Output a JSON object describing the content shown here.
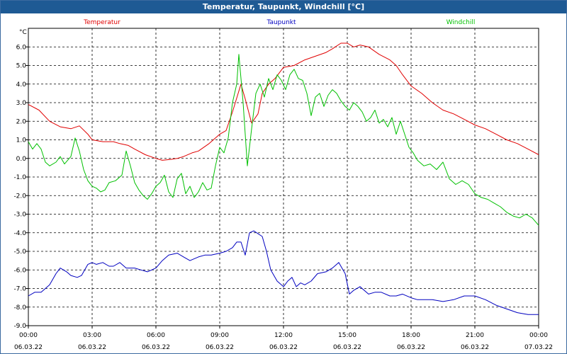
{
  "window": {
    "title": "Temperatur, Taupunkt, Windchill [°C]"
  },
  "legend": {
    "temperatur": {
      "label": "Temperatur",
      "color": "#e00000"
    },
    "taupunkt": {
      "label": "Taupunkt",
      "color": "#0000c0"
    },
    "windchill": {
      "label": "Windchill",
      "color": "#00c000"
    }
  },
  "chart_data": {
    "type": "line",
    "title": "Temperatur, Taupunkt, Windchill [°C]",
    "ylabel": "°C",
    "xlabel": "",
    "ylim": [
      -9.0,
      7.0
    ],
    "xlim": [
      0,
      24
    ],
    "yticks": [
      6.0,
      5.0,
      4.0,
      3.0,
      2.0,
      1.0,
      0.0,
      -1.0,
      -2.0,
      -3.0,
      -4.0,
      -5.0,
      -6.0,
      -7.0,
      -8.0,
      -9.0
    ],
    "ytick_labels": [
      "6.0",
      "5.0",
      "4.0",
      "3.0",
      "2.0",
      "1.0",
      "0.0",
      "-1.0",
      "-2.0",
      "-3.0",
      "-4.0",
      "-5.0",
      "-6.0",
      "-7.0",
      "-8.0",
      "-9.0"
    ],
    "xticks": [
      {
        "x": 0,
        "time": "00:00",
        "date": "06.03.22"
      },
      {
        "x": 3,
        "time": "03:00",
        "date": "06.03.22"
      },
      {
        "x": 6,
        "time": "06:00",
        "date": "06.03.22"
      },
      {
        "x": 9,
        "time": "09:00",
        "date": "06.03.22"
      },
      {
        "x": 12,
        "time": "12:00",
        "date": "06.03.22"
      },
      {
        "x": 15,
        "time": "15:00",
        "date": "06.03.22"
      },
      {
        "x": 18,
        "time": "18:00",
        "date": "06.03.22"
      },
      {
        "x": 21,
        "time": "21:00",
        "date": "06.03.22"
      },
      {
        "x": 24,
        "time": "00:00",
        "date": "07.03.22"
      }
    ],
    "grid": true,
    "legend_position": "top",
    "series": [
      {
        "name": "Temperatur",
        "color": "#e00000",
        "points": [
          [
            0,
            2.9
          ],
          [
            0.5,
            2.6
          ],
          [
            1,
            2.0
          ],
          [
            1.5,
            1.7
          ],
          [
            2,
            1.6
          ],
          [
            2.4,
            1.75
          ],
          [
            2.8,
            1.3
          ],
          [
            3,
            1.0
          ],
          [
            3.5,
            0.9
          ],
          [
            4,
            0.9
          ],
          [
            4.3,
            0.8
          ],
          [
            4.7,
            0.7
          ],
          [
            5,
            0.5
          ],
          [
            5.5,
            0.2
          ],
          [
            6,
            0.0
          ],
          [
            6.3,
            -0.1
          ],
          [
            6.7,
            -0.05
          ],
          [
            7,
            0.0
          ],
          [
            7.3,
            0.1
          ],
          [
            7.7,
            0.3
          ],
          [
            8,
            0.4
          ],
          [
            8.5,
            0.8
          ],
          [
            9,
            1.3
          ],
          [
            9.3,
            1.5
          ],
          [
            9.6,
            2.5
          ],
          [
            10,
            4.0
          ],
          [
            10.2,
            3.2
          ],
          [
            10.5,
            1.9
          ],
          [
            10.8,
            2.4
          ],
          [
            11,
            3.5
          ],
          [
            11.3,
            4.0
          ],
          [
            11.6,
            4.3
          ],
          [
            12,
            4.9
          ],
          [
            12.5,
            5.0
          ],
          [
            13,
            5.3
          ],
          [
            13.5,
            5.5
          ],
          [
            14,
            5.7
          ],
          [
            14.3,
            5.9
          ],
          [
            14.7,
            6.2
          ],
          [
            15,
            6.2
          ],
          [
            15.3,
            6.0
          ],
          [
            15.6,
            6.1
          ],
          [
            16,
            6.0
          ],
          [
            16.5,
            5.6
          ],
          [
            17,
            5.3
          ],
          [
            17.3,
            5.0
          ],
          [
            17.6,
            4.5
          ],
          [
            18,
            3.9
          ],
          [
            18.5,
            3.5
          ],
          [
            19,
            3.0
          ],
          [
            19.5,
            2.6
          ],
          [
            20,
            2.4
          ],
          [
            20.5,
            2.1
          ],
          [
            21,
            1.8
          ],
          [
            21.5,
            1.6
          ],
          [
            22,
            1.3
          ],
          [
            22.5,
            1.0
          ],
          [
            23,
            0.8
          ],
          [
            23.5,
            0.5
          ],
          [
            24,
            0.2
          ]
        ]
      },
      {
        "name": "Taupunkt",
        "color": "#0000c0",
        "points": [
          [
            0,
            -7.4
          ],
          [
            0.3,
            -7.2
          ],
          [
            0.6,
            -7.2
          ],
          [
            1,
            -6.8
          ],
          [
            1.3,
            -6.2
          ],
          [
            1.5,
            -5.9
          ],
          [
            1.8,
            -6.1
          ],
          [
            2,
            -6.3
          ],
          [
            2.3,
            -6.4
          ],
          [
            2.5,
            -6.3
          ],
          [
            2.8,
            -5.7
          ],
          [
            3,
            -5.6
          ],
          [
            3.2,
            -5.7
          ],
          [
            3.5,
            -5.6
          ],
          [
            3.8,
            -5.8
          ],
          [
            4,
            -5.8
          ],
          [
            4.3,
            -5.6
          ],
          [
            4.6,
            -5.9
          ],
          [
            5,
            -5.9
          ],
          [
            5.3,
            -6.0
          ],
          [
            5.6,
            -6.1
          ],
          [
            6,
            -5.9
          ],
          [
            6.3,
            -5.5
          ],
          [
            6.6,
            -5.2
          ],
          [
            7,
            -5.1
          ],
          [
            7.3,
            -5.3
          ],
          [
            7.6,
            -5.5
          ],
          [
            8,
            -5.3
          ],
          [
            8.3,
            -5.2
          ],
          [
            8.6,
            -5.2
          ],
          [
            9,
            -5.1
          ],
          [
            9.3,
            -5.0
          ],
          [
            9.6,
            -4.8
          ],
          [
            9.8,
            -4.5
          ],
          [
            10,
            -4.5
          ],
          [
            10.2,
            -5.2
          ],
          [
            10.4,
            -4.0
          ],
          [
            10.6,
            -3.9
          ],
          [
            11,
            -4.2
          ],
          [
            11.2,
            -5.0
          ],
          [
            11.4,
            -6.0
          ],
          [
            11.7,
            -6.6
          ],
          [
            12,
            -6.9
          ],
          [
            12.2,
            -6.6
          ],
          [
            12.4,
            -6.4
          ],
          [
            12.6,
            -6.9
          ],
          [
            12.8,
            -6.7
          ],
          [
            13,
            -6.8
          ],
          [
            13.3,
            -6.6
          ],
          [
            13.6,
            -6.2
          ],
          [
            14,
            -6.1
          ],
          [
            14.3,
            -5.9
          ],
          [
            14.6,
            -5.6
          ],
          [
            14.9,
            -6.2
          ],
          [
            15.1,
            -7.3
          ],
          [
            15.3,
            -7.1
          ],
          [
            15.6,
            -6.9
          ],
          [
            16,
            -7.3
          ],
          [
            16.3,
            -7.2
          ],
          [
            16.6,
            -7.2
          ],
          [
            17,
            -7.4
          ],
          [
            17.3,
            -7.4
          ],
          [
            17.6,
            -7.3
          ],
          [
            18,
            -7.5
          ],
          [
            18.3,
            -7.6
          ],
          [
            18.6,
            -7.6
          ],
          [
            19,
            -7.6
          ],
          [
            19.5,
            -7.7
          ],
          [
            20,
            -7.6
          ],
          [
            20.5,
            -7.4
          ],
          [
            21,
            -7.4
          ],
          [
            21.5,
            -7.6
          ],
          [
            22,
            -7.9
          ],
          [
            22.5,
            -8.1
          ],
          [
            23,
            -8.3
          ],
          [
            23.5,
            -8.4
          ],
          [
            24,
            -8.4
          ]
        ]
      },
      {
        "name": "Windchill",
        "color": "#00c000",
        "points": [
          [
            0,
            0.9
          ],
          [
            0.2,
            0.5
          ],
          [
            0.4,
            0.8
          ],
          [
            0.6,
            0.5
          ],
          [
            0.8,
            -0.2
          ],
          [
            1,
            -0.4
          ],
          [
            1.3,
            -0.2
          ],
          [
            1.5,
            0.1
          ],
          [
            1.7,
            -0.3
          ],
          [
            2,
            0.1
          ],
          [
            2.2,
            1.1
          ],
          [
            2.4,
            0.4
          ],
          [
            2.6,
            -0.6
          ],
          [
            2.8,
            -1.2
          ],
          [
            3,
            -1.5
          ],
          [
            3.2,
            -1.6
          ],
          [
            3.4,
            -1.8
          ],
          [
            3.6,
            -1.7
          ],
          [
            3.8,
            -1.3
          ],
          [
            4.1,
            -1.2
          ],
          [
            4.4,
            -0.9
          ],
          [
            4.6,
            0.4
          ],
          [
            4.8,
            -0.4
          ],
          [
            5,
            -1.3
          ],
          [
            5.2,
            -1.7
          ],
          [
            5.4,
            -2.0
          ],
          [
            5.6,
            -2.2
          ],
          [
            5.8,
            -1.9
          ],
          [
            6,
            -1.5
          ],
          [
            6.2,
            -1.3
          ],
          [
            6.4,
            -0.9
          ],
          [
            6.6,
            -1.8
          ],
          [
            6.8,
            -2.1
          ],
          [
            7,
            -1.1
          ],
          [
            7.2,
            -0.8
          ],
          [
            7.4,
            -1.9
          ],
          [
            7.6,
            -1.5
          ],
          [
            7.8,
            -2.1
          ],
          [
            8,
            -1.8
          ],
          [
            8.2,
            -1.3
          ],
          [
            8.4,
            -1.7
          ],
          [
            8.6,
            -1.6
          ],
          [
            8.8,
            -0.4
          ],
          [
            9,
            0.6
          ],
          [
            9.2,
            0.3
          ],
          [
            9.4,
            1.1
          ],
          [
            9.6,
            3.0
          ],
          [
            9.8,
            4.0
          ],
          [
            9.9,
            5.6
          ],
          [
            10.1,
            3.0
          ],
          [
            10.3,
            -0.4
          ],
          [
            10.5,
            1.6
          ],
          [
            10.7,
            3.5
          ],
          [
            10.9,
            4.0
          ],
          [
            11.1,
            3.3
          ],
          [
            11.3,
            4.3
          ],
          [
            11.5,
            3.7
          ],
          [
            11.7,
            4.5
          ],
          [
            11.9,
            4.2
          ],
          [
            12.1,
            3.7
          ],
          [
            12.3,
            4.5
          ],
          [
            12.5,
            4.8
          ],
          [
            12.7,
            4.3
          ],
          [
            12.9,
            4.2
          ],
          [
            13.1,
            3.5
          ],
          [
            13.3,
            2.3
          ],
          [
            13.5,
            3.3
          ],
          [
            13.7,
            3.5
          ],
          [
            13.9,
            2.8
          ],
          [
            14.1,
            3.4
          ],
          [
            14.3,
            3.7
          ],
          [
            14.5,
            3.5
          ],
          [
            14.7,
            3.1
          ],
          [
            14.9,
            2.8
          ],
          [
            15.1,
            2.6
          ],
          [
            15.3,
            3.0
          ],
          [
            15.5,
            2.8
          ],
          [
            15.7,
            2.5
          ],
          [
            15.9,
            2.0
          ],
          [
            16.1,
            2.2
          ],
          [
            16.3,
            2.6
          ],
          [
            16.5,
            1.9
          ],
          [
            16.7,
            2.1
          ],
          [
            16.9,
            1.7
          ],
          [
            17.1,
            2.2
          ],
          [
            17.3,
            1.3
          ],
          [
            17.5,
            2.0
          ],
          [
            17.7,
            1.3
          ],
          [
            17.9,
            0.6
          ],
          [
            18.1,
            0.3
          ],
          [
            18.3,
            -0.1
          ],
          [
            18.6,
            -0.4
          ],
          [
            18.9,
            -0.3
          ],
          [
            19.2,
            -0.6
          ],
          [
            19.5,
            -0.2
          ],
          [
            19.8,
            -1.1
          ],
          [
            20.1,
            -1.4
          ],
          [
            20.4,
            -1.2
          ],
          [
            20.7,
            -1.4
          ],
          [
            21,
            -1.9
          ],
          [
            21.3,
            -2.1
          ],
          [
            21.6,
            -2.2
          ],
          [
            21.9,
            -2.4
          ],
          [
            22.2,
            -2.6
          ],
          [
            22.5,
            -2.9
          ],
          [
            22.8,
            -3.1
          ],
          [
            23.1,
            -3.2
          ],
          [
            23.4,
            -3.0
          ],
          [
            23.7,
            -3.2
          ],
          [
            24,
            -3.6
          ]
        ]
      }
    ]
  }
}
